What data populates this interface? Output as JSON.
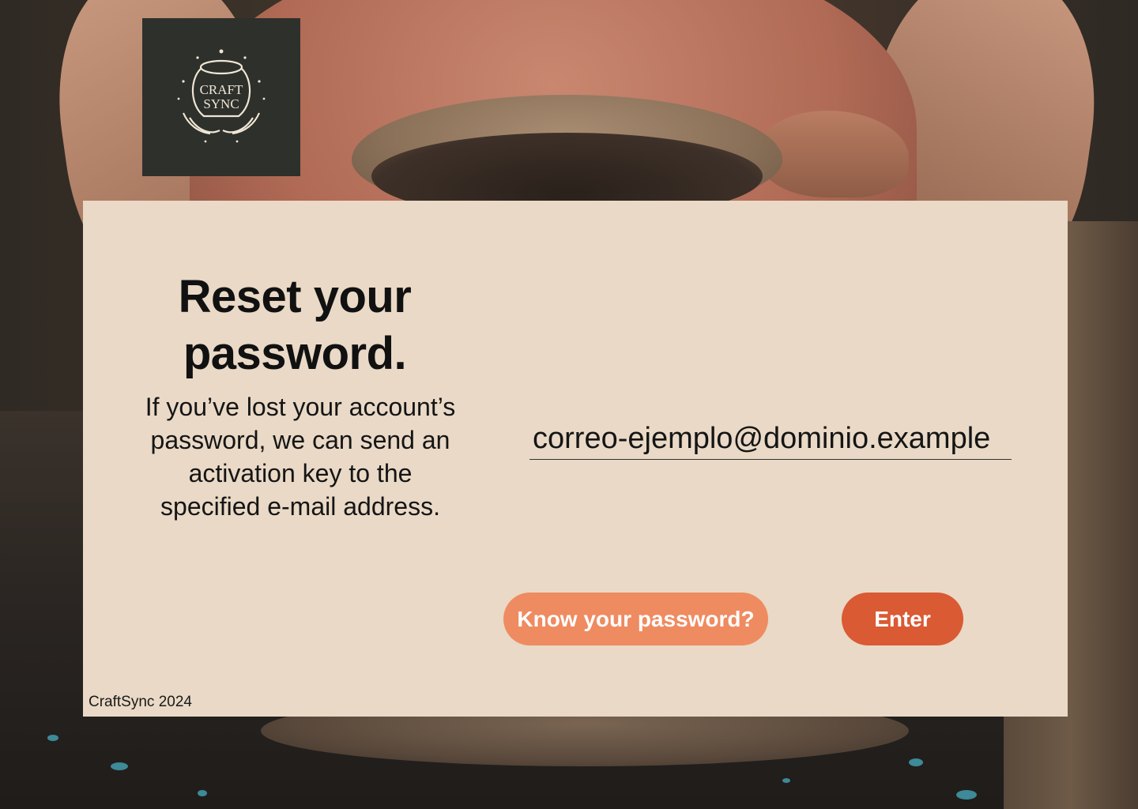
{
  "brand": {
    "logo_line1": "CRAFT",
    "logo_line2": "SYNC",
    "logo_icon": "craftsync-pot-hands-logo"
  },
  "reset": {
    "title_line1": "Reset your",
    "title_line2": "password.",
    "description": "If you’ve lost your account’s password, we can send an activation key to the specified e-mail address."
  },
  "form": {
    "email_value": "correo-ejemplo@dominio.example"
  },
  "actions": {
    "know_password_label": "Know your password?",
    "enter_label": "Enter"
  },
  "footer": {
    "copyright": "CraftSync 2024"
  },
  "colors": {
    "panel_bg": "#e9d9c6",
    "secondary_button": "#ef8b60",
    "primary_button": "#d95a33",
    "logo_bg": "#2e302c"
  }
}
